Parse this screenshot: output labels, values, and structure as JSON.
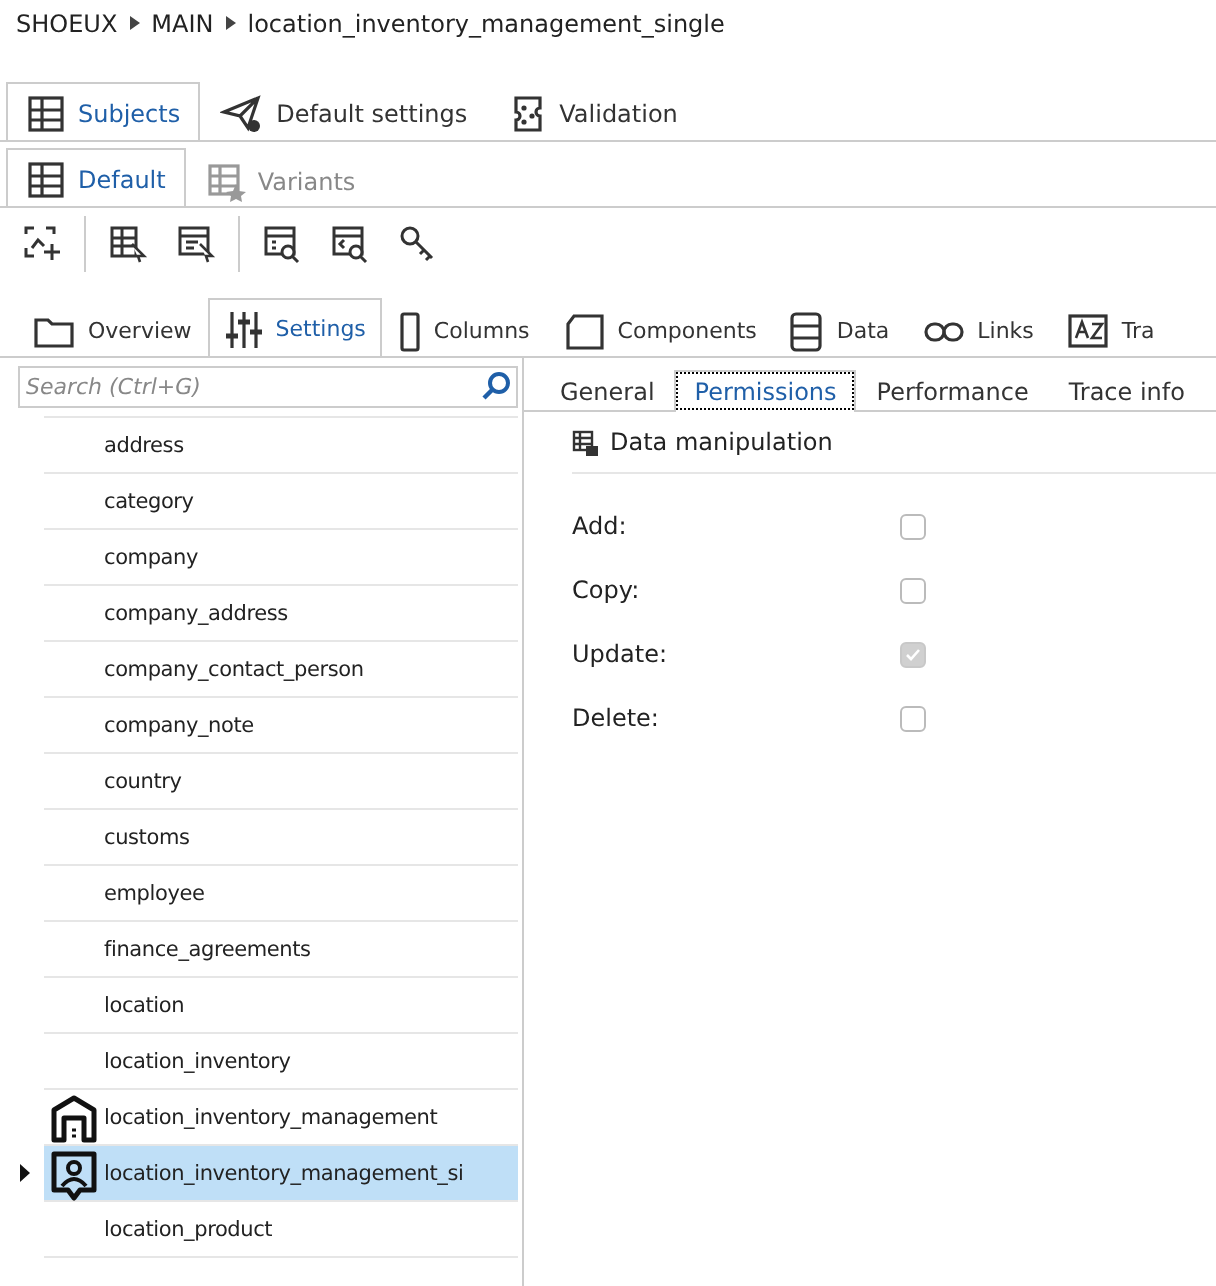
{
  "breadcrumb": [
    "SHOEUX",
    "MAIN",
    "location_inventory_management_single"
  ],
  "main_tabs": [
    {
      "label": "Subjects",
      "selected": true
    },
    {
      "label": "Default settings",
      "selected": false
    },
    {
      "label": "Validation",
      "selected": false
    }
  ],
  "sub_tabs": [
    {
      "label": "Default",
      "selected": true
    },
    {
      "label": "Variants",
      "selected": false
    }
  ],
  "section_tabs": [
    {
      "label": "Overview",
      "selected": false
    },
    {
      "label": "Settings",
      "selected": true
    },
    {
      "label": "Columns",
      "selected": false
    },
    {
      "label": "Components",
      "selected": false
    },
    {
      "label": "Data",
      "selected": false
    },
    {
      "label": "Links",
      "selected": false
    },
    {
      "label": "Tra",
      "selected": false
    }
  ],
  "search": {
    "placeholder": "Search (Ctrl+G)"
  },
  "tree": [
    {
      "label": "address",
      "kind": "plain",
      "selected": false,
      "collapsed": false
    },
    {
      "label": "category",
      "kind": "plain",
      "selected": false,
      "collapsed": false
    },
    {
      "label": "company",
      "kind": "plain",
      "selected": false,
      "collapsed": false
    },
    {
      "label": "company_address",
      "kind": "plain",
      "selected": false,
      "collapsed": false
    },
    {
      "label": "company_contact_person",
      "kind": "plain",
      "selected": false,
      "collapsed": false
    },
    {
      "label": "company_note",
      "kind": "plain",
      "selected": false,
      "collapsed": false
    },
    {
      "label": "country",
      "kind": "plain",
      "selected": false,
      "collapsed": false
    },
    {
      "label": "customs",
      "kind": "plain",
      "selected": false,
      "collapsed": false
    },
    {
      "label": "employee",
      "kind": "plain",
      "selected": false,
      "collapsed": false
    },
    {
      "label": "finance_agreements",
      "kind": "plain",
      "selected": false,
      "collapsed": false
    },
    {
      "label": "location",
      "kind": "plain",
      "selected": false,
      "collapsed": false
    },
    {
      "label": "location_inventory",
      "kind": "plain",
      "selected": false,
      "collapsed": false
    },
    {
      "label": "location_inventory_management",
      "kind": "house",
      "selected": false,
      "collapsed": false
    },
    {
      "label": "location_inventory_management_si",
      "kind": "person",
      "selected": true,
      "collapsed": true
    },
    {
      "label": "location_product",
      "kind": "plain",
      "selected": false,
      "collapsed": false
    }
  ],
  "detail_tabs": [
    {
      "label": "General",
      "selected": false
    },
    {
      "label": "Permissions",
      "selected": true
    },
    {
      "label": "Performance",
      "selected": false
    },
    {
      "label": "Trace info",
      "selected": false
    }
  ],
  "group": {
    "title": "Data manipulation"
  },
  "permissions": [
    {
      "label": "Add:",
      "checked": false,
      "disabled": false
    },
    {
      "label": "Copy:",
      "checked": false,
      "disabled": false
    },
    {
      "label": "Update:",
      "checked": true,
      "disabled": true
    },
    {
      "label": "Delete:",
      "checked": false,
      "disabled": false
    }
  ]
}
